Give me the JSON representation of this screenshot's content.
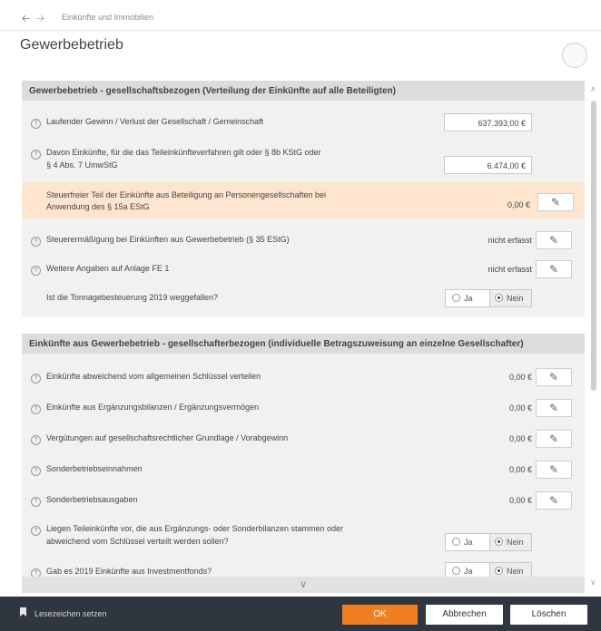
{
  "nav": {
    "back_icon": "arrow-left-icon",
    "forward_icon": "arrow-right-icon",
    "breadcrumb": "Einkünfte und Immobilien"
  },
  "page": {
    "title": "Gewerbebetrieb"
  },
  "section1": {
    "title": "Gewerbebetrieb - gesellschaftsbezogen (Verteilung der Einkünfte auf alle Beteiligten)",
    "rows": [
      {
        "label": "Laufender Gewinn / Verlust der Gesellschaft / Gemeinschaft",
        "value": "637.393,00 €"
      },
      {
        "label": "Davon Einkünfte, für die das Teileinkünfteverfahren gilt oder § 8b KStG oder",
        "label2": "§ 4 Abs. 7 UmwStG",
        "value": "6.474,00 €"
      },
      {
        "label": "Steuerfreier Teil der Einkünfte aus Beteiligung an Personengesellschaften bei",
        "label2": "Anwendung des § 15a EStG",
        "value": "0,00 €"
      },
      {
        "label": "Steuerermäßigung bei Einkünften aus Gewerbebetrieb (§ 35 EStG)",
        "value": "nicht erfasst"
      },
      {
        "label": "Weitere Angaben auf Anlage FE 1",
        "value": "nicht erfasst"
      },
      {
        "label": "Ist die Tonnagebesteuerung 2019 weggefallen?",
        "yes": "Ja",
        "no": "Nein"
      }
    ]
  },
  "section2": {
    "title": "Einkünfte aus Gewerbebetrieb - gesellschafterbezogen (individuelle Betragszuweisung an einzelne Gesellschafter)",
    "rows": [
      {
        "label": "Einkünfte abweichend vom allgemeinen Schlüssel verteilen",
        "value": "0,00 €"
      },
      {
        "label": "Einkünfte aus Ergänzungsbilanzen / Ergänzungsvermögen",
        "value": "0,00 €"
      },
      {
        "label": "Vergütungen auf gesellschaftsrechtlicher Grundlage / Vorabgewinn",
        "value": "0,00 €"
      },
      {
        "label": "Sonderbetriebseinnahmen",
        "value": "0,00 €"
      },
      {
        "label": "Sonderbetriebsausgaben",
        "value": "0,00 €"
      },
      {
        "label": "Liegen Teileinkünfte vor, die aus Ergänzungs- oder Sonderbilanzen stammen oder",
        "label2": "abweichend vom Schlüssel verteilt werden sollen?",
        "yes": "Ja",
        "no": "Nein"
      },
      {
        "label": "Gab es 2019 Einkünfte aus Investmentfonds?",
        "yes": "Ja",
        "no": "Nein"
      }
    ]
  },
  "icons": {
    "help": "help-circle-icon",
    "edit": "pencil-icon",
    "bookmark": "bookmark-icon",
    "more": "chevron-down-icon"
  },
  "footer": {
    "bookmark_label": "Lesezeichen setzen",
    "ok": "OK",
    "cancel": "Abbrechen",
    "delete": "Löschen"
  },
  "colors": {
    "accent": "#f07f24",
    "highlight": "#fde5cf",
    "footer_bg": "#303640"
  }
}
